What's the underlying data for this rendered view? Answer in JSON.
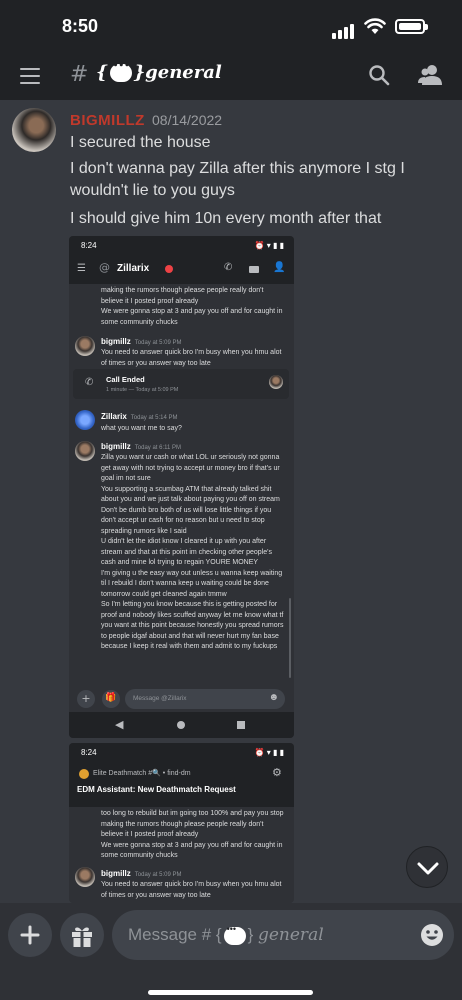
{
  "status_bar": {
    "time": "8:50"
  },
  "header": {
    "hash": "#",
    "channel_name": "general"
  },
  "message": {
    "author": "BIGMILLZ",
    "timestamp": "08/14/2022",
    "lines": [
      "I secured the house",
      "I don't wanna pay Zilla after this anymore I stg I wouldn't lie to you guys",
      "I should give him 10n every month after that"
    ]
  },
  "screenshot1": {
    "time": "8:24",
    "title": "Zillarix",
    "top_text": "making the rumors though please people really don't believe it I posted proof already\nWe were gonna stop at 3 and pay you off and for caught in some community chucks",
    "msg1_author": "bigmillz",
    "msg1_time": "Today at 5:09 PM",
    "msg1_text": "You need to answer quick bro I'm busy when you hmu alot of times or you answer way too late",
    "call_title": "Call Ended",
    "call_sub": "1 minute — Today at 5:09 PM",
    "msg2_author": "Zillarix",
    "msg2_time": "Today at 5:14 PM",
    "msg2_text": "what you want me to say?",
    "msg3_author": "bigmillz",
    "msg3_time": "Today at 6:11 PM",
    "msg3_text": "Zilla you want ur cash or what LOL ur seriously not gonna get away with not trying to accept ur money bro if that's ur goal im not sure\nYou supporting a scumbag ATM that already talked shit about you and we just talk about paying you off on stream\nDon't be dumb bro both of us will lose little things if you don't accept ur cash for no reason but u need to stop spreading rumors like I said\nU didn't let the idiot know I cleared it up with you after stream and that at this point im checking other people's cash and mine lol trying to regain YOURE MONEY\nI'm giving u the easy way out unless u wanna keep waiting til I rebuild I don't wanna keep u waiting could be done tomorrow could get cleaned again tmmw\nSo I'm letting you know because this is getting posted for proof and nobody likes scuffed anyway let me know what tf you want at this point because honestly you spread rumors to people idgaf about and that will never hurt my fan base because I keep it real with them and admit to my fuckups",
    "composer_placeholder": "Message @Zillarix"
  },
  "screenshot2": {
    "time": "8:24",
    "server_channel": "Elite Deathmatch #🔍 • find-dm",
    "thread_title": "EDM Assistant: New Deathmatch Request",
    "top_text": "too long to rebuild but im going too 100% and pay you stop making the rumors though please people really don't believe it I posted proof already\nWe were gonna stop at 3 and pay you off and for caught in some community chucks",
    "msg1_author": "bigmillz",
    "msg1_time": "Today at 5:09 PM",
    "msg1_text": "You need to answer quick bro I'm busy when you hmu alot of times or you answer way too late"
  },
  "composer": {
    "placeholder_prefix": "Message #",
    "placeholder_channel": "general"
  }
}
